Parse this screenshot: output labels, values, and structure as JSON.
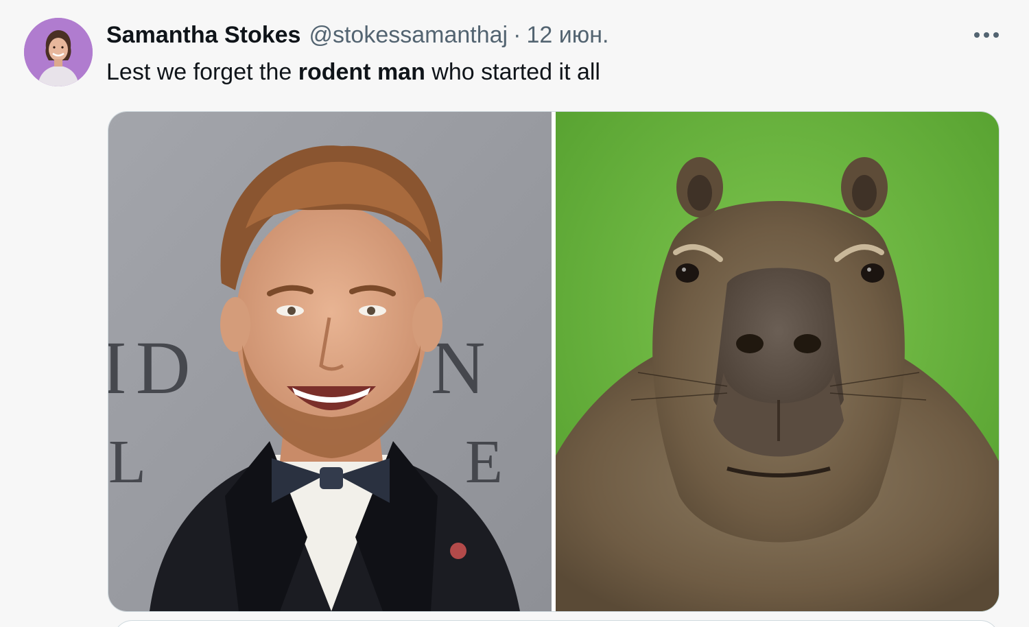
{
  "tweet": {
    "author": {
      "display_name": "Samantha Stokes",
      "handle": "@stokessamanthaj",
      "avatar_icon": "user-avatar-photo"
    },
    "separator": "·",
    "date": "12 июн.",
    "more_icon": "more-horizontal-icon",
    "text_before": "Lest we forget the ",
    "text_bold": "rodent man",
    "text_after": " who started it all",
    "media": [
      {
        "subject": "man-in-tuxedo-photo"
      },
      {
        "subject": "capybara-photo"
      }
    ]
  },
  "colors": {
    "text_primary": "#0f1419",
    "text_secondary": "#536471",
    "border": "#cfd9de",
    "background": "#f7f7f7",
    "avatar_bg": "#b07ccf"
  }
}
